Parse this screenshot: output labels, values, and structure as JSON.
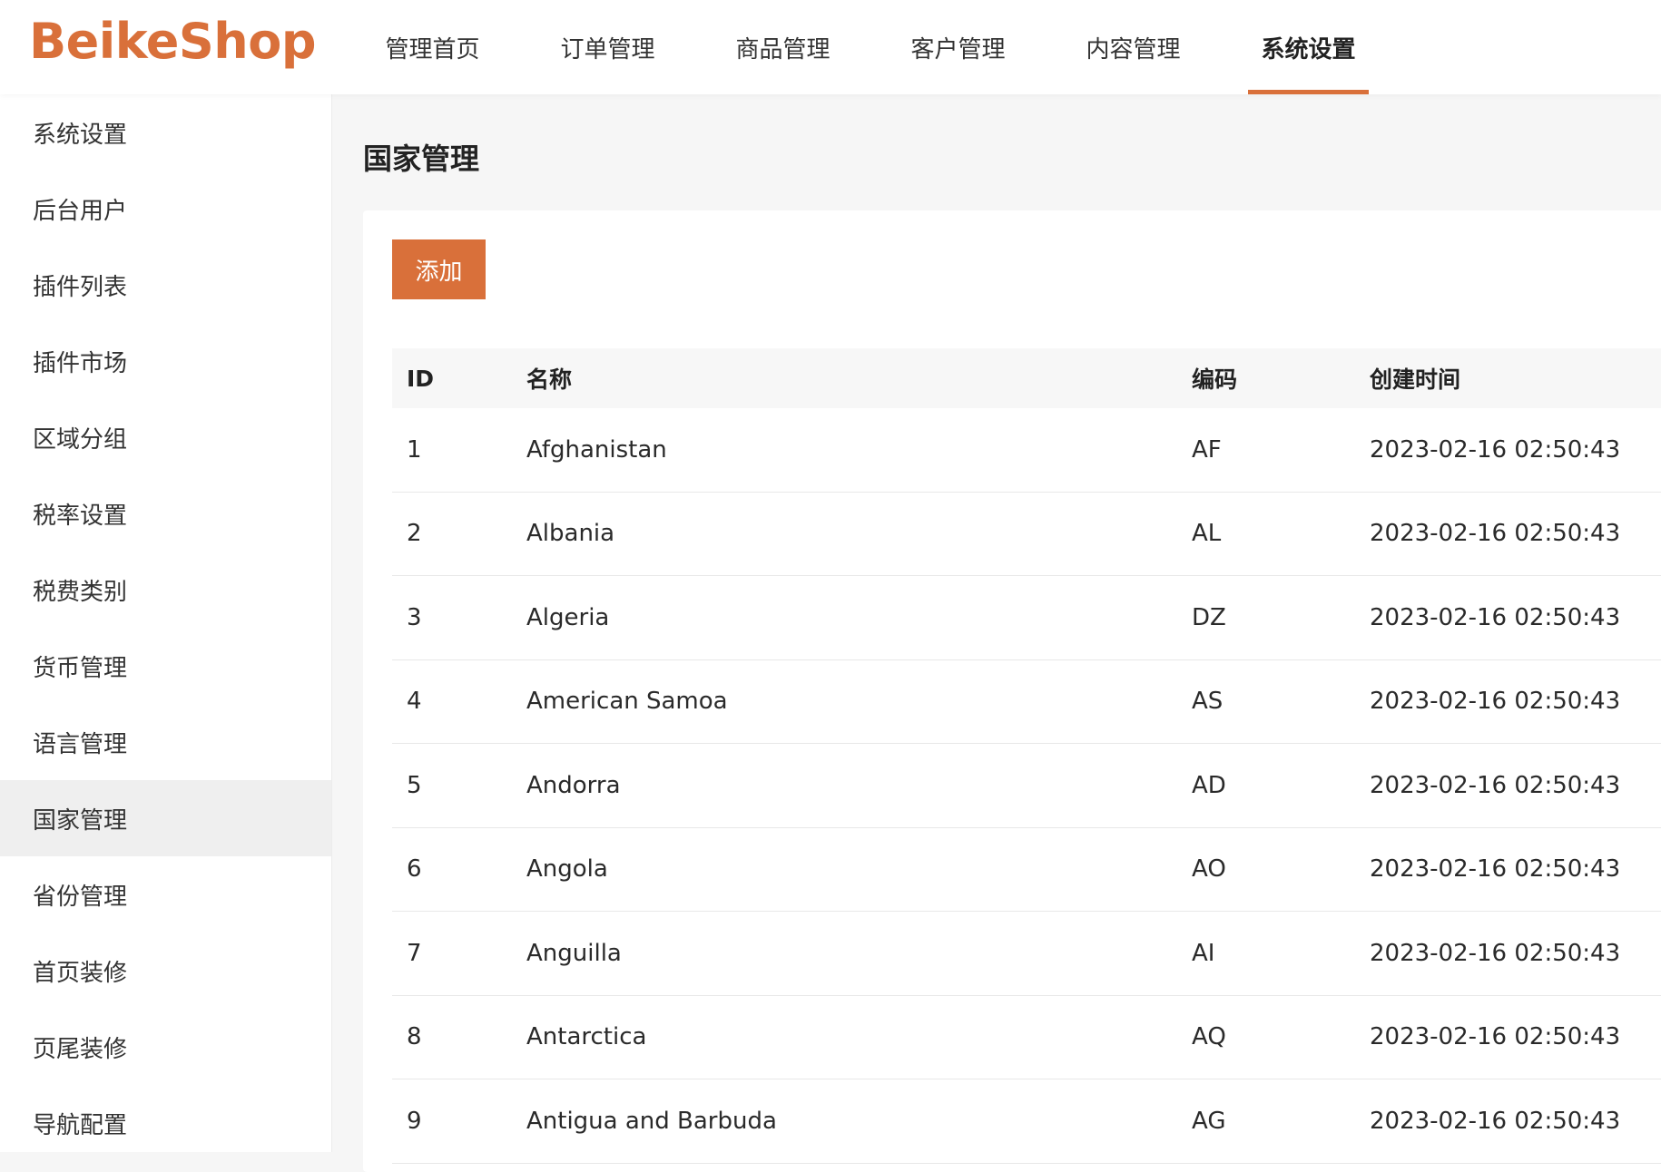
{
  "brand": {
    "logo": "BeikeShop",
    "accent_color": "#d9703a"
  },
  "topnav": {
    "items": [
      {
        "label": "管理首页"
      },
      {
        "label": "订单管理"
      },
      {
        "label": "商品管理"
      },
      {
        "label": "客户管理"
      },
      {
        "label": "内容管理"
      },
      {
        "label": "系统设置",
        "active": true
      }
    ]
  },
  "sidebar": {
    "items": [
      {
        "label": "系统设置"
      },
      {
        "label": "后台用户"
      },
      {
        "label": "插件列表"
      },
      {
        "label": "插件市场"
      },
      {
        "label": "区域分组"
      },
      {
        "label": "税率设置"
      },
      {
        "label": "税费类别"
      },
      {
        "label": "货币管理"
      },
      {
        "label": "语言管理"
      },
      {
        "label": "国家管理",
        "active": true
      },
      {
        "label": "省份管理"
      },
      {
        "label": "首页装修"
      },
      {
        "label": "页尾装修"
      },
      {
        "label": "导航配置"
      }
    ]
  },
  "page": {
    "title": "国家管理",
    "add_button": "添加"
  },
  "table": {
    "headers": {
      "id": "ID",
      "name": "名称",
      "code": "编码",
      "created": "创建时间"
    },
    "rows": [
      {
        "id": "1",
        "name": "Afghanistan",
        "code": "AF",
        "created": "2023-02-16 02:50:43"
      },
      {
        "id": "2",
        "name": "Albania",
        "code": "AL",
        "created": "2023-02-16 02:50:43"
      },
      {
        "id": "3",
        "name": "Algeria",
        "code": "DZ",
        "created": "2023-02-16 02:50:43"
      },
      {
        "id": "4",
        "name": "American Samoa",
        "code": "AS",
        "created": "2023-02-16 02:50:43"
      },
      {
        "id": "5",
        "name": "Andorra",
        "code": "AD",
        "created": "2023-02-16 02:50:43"
      },
      {
        "id": "6",
        "name": "Angola",
        "code": "AO",
        "created": "2023-02-16 02:50:43"
      },
      {
        "id": "7",
        "name": "Anguilla",
        "code": "AI",
        "created": "2023-02-16 02:50:43"
      },
      {
        "id": "8",
        "name": "Antarctica",
        "code": "AQ",
        "created": "2023-02-16 02:50:43"
      },
      {
        "id": "9",
        "name": "Antigua and Barbuda",
        "code": "AG",
        "created": "2023-02-16 02:50:43"
      }
    ]
  }
}
